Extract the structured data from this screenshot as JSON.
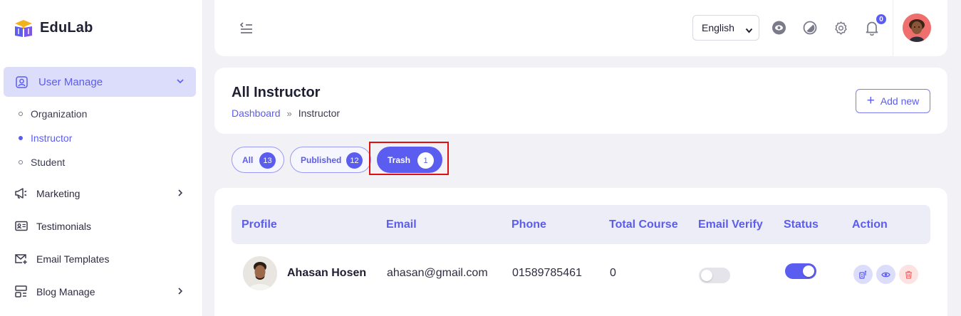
{
  "brand": {
    "name": "EduLab"
  },
  "sidebar": {
    "active_section": "User Manage",
    "sub_items": [
      {
        "label": "Organization",
        "active": false
      },
      {
        "label": "Instructor",
        "active": true
      },
      {
        "label": "Student",
        "active": false
      }
    ],
    "items": [
      {
        "label": "Marketing",
        "icon": "megaphone-icon",
        "has_submenu": true
      },
      {
        "label": "Testimonials",
        "icon": "id-card-icon",
        "has_submenu": false
      },
      {
        "label": "Email Templates",
        "icon": "mail-plus-icon",
        "has_submenu": false
      },
      {
        "label": "Blog Manage",
        "icon": "layout-icon",
        "has_submenu": true
      }
    ]
  },
  "topbar": {
    "language": "English",
    "notification_count": "0"
  },
  "page": {
    "title": "All Instructor",
    "breadcrumb": {
      "root": "Dashboard",
      "separator": "»",
      "current": "Instructor"
    },
    "add_button": "Add new"
  },
  "tabs": [
    {
      "label": "All",
      "count": "13",
      "active": false
    },
    {
      "label": "Published",
      "count": "12",
      "active": false
    },
    {
      "label": "Trash",
      "count": "1",
      "active": true
    }
  ],
  "table": {
    "columns": [
      "Profile",
      "Email",
      "Phone",
      "Total Course",
      "Email Verify",
      "Status",
      "Action"
    ],
    "rows": [
      {
        "name": "Ahasan Hosen",
        "email": "ahasan@gmail.com",
        "phone": "01589785461",
        "total_course": "0",
        "email_verify": false,
        "status": true
      }
    ]
  },
  "colors": {
    "accent": "#5b5cf0",
    "highlight_border": "#e01010",
    "delete": "#f26b6b"
  }
}
